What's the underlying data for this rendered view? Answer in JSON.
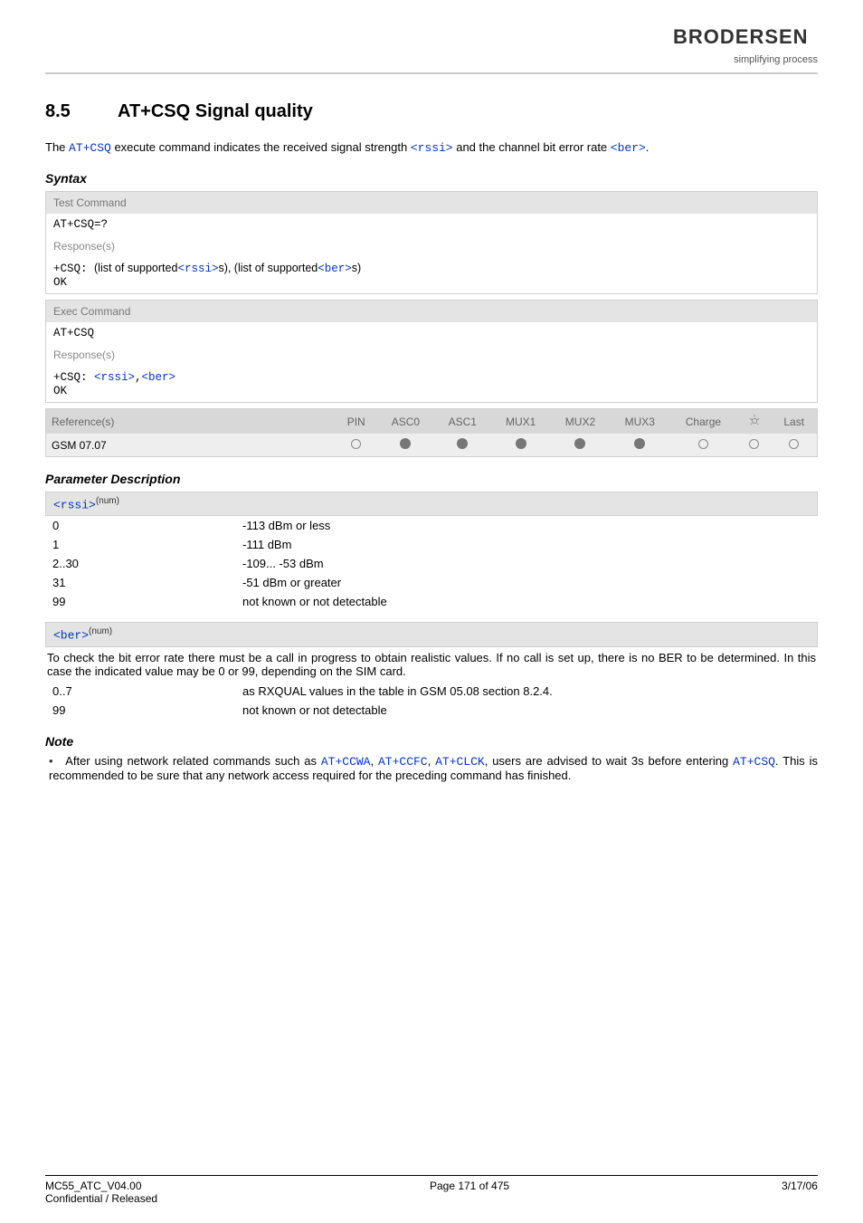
{
  "header": {
    "logo": "BRODERSEN",
    "tagline": "simplifying process"
  },
  "section": {
    "number": "8.5",
    "title": "AT+CSQ   Signal quality"
  },
  "intro": {
    "pre": "The ",
    "cmd": "AT+CSQ",
    "mid": " execute command indicates the received signal strength ",
    "rssi": "<rssi>",
    "mid2": " and the channel bit error rate ",
    "ber": "<ber>",
    "end": "."
  },
  "syntax_label": "Syntax",
  "test_block": {
    "hdr": "Test Command",
    "cmd": "AT+CSQ=?",
    "resp_label": "Response(s)",
    "resp_pre": "+CSQ: ",
    "resp_text1": "(list of supported",
    "resp_rssi": "<rssi>",
    "resp_text2": "s), (list of supported",
    "resp_ber": "<ber>",
    "resp_text3": "s)",
    "ok": "OK"
  },
  "exec_block": {
    "hdr": "Exec Command",
    "cmd": "AT+CSQ",
    "resp_label": "Response(s)",
    "resp_pre": "+CSQ: ",
    "resp_rssi": "<rssi>",
    "comma": ",",
    "resp_ber": "<ber>",
    "ok": "OK"
  },
  "ref_table": {
    "headers": [
      "Reference(s)",
      "PIN",
      "ASC0",
      "ASC1",
      "MUX1",
      "MUX2",
      "MUX3",
      "Charge",
      "",
      "Last"
    ],
    "row_label": "GSM 07.07",
    "cells": [
      "open",
      "fill",
      "fill",
      "fill",
      "fill",
      "fill",
      "open",
      "open",
      "open"
    ]
  },
  "param_label": "Parameter Description",
  "rssi_param": {
    "name": "<rssi>",
    "sup": "(num)",
    "rows": [
      {
        "k": "0",
        "v": "-113 dBm or less"
      },
      {
        "k": "1",
        "v": "-111 dBm"
      },
      {
        "k": "2..30",
        "v": "-109... -53 dBm"
      },
      {
        "k": "31",
        "v": "-51 dBm or greater"
      },
      {
        "k": "99",
        "v": "not known or not detectable"
      }
    ]
  },
  "ber_param": {
    "name": "<ber>",
    "sup": "(num)",
    "desc": "To check the bit error rate there must be a call in progress to obtain realistic values. If no call is set up, there is no BER to be determined. In this case the indicated value may be 0 or 99, depending on the SIM card.",
    "rows": [
      {
        "k": "0..7",
        "v": "as RXQUAL values in the table in GSM 05.08 section 8.2.4."
      },
      {
        "k": "99",
        "v": "not known or not detectable"
      }
    ]
  },
  "note_label": "Note",
  "note": {
    "pre": "After using network related commands such as ",
    "c1": "AT+CCWA",
    "s1": ", ",
    "c2": "AT+CCFC",
    "s2": ", ",
    "c3": "AT+CLCK",
    "mid": ", users are advised to wait 3s before entering ",
    "c4": "AT+CSQ",
    "end": ". This is recommended to be sure that any network access required for the preceding command has finished."
  },
  "footer": {
    "left1": "MC55_ATC_V04.00",
    "left2": "Confidential / Released",
    "center": "Page 171 of 475",
    "right": "3/17/06"
  }
}
